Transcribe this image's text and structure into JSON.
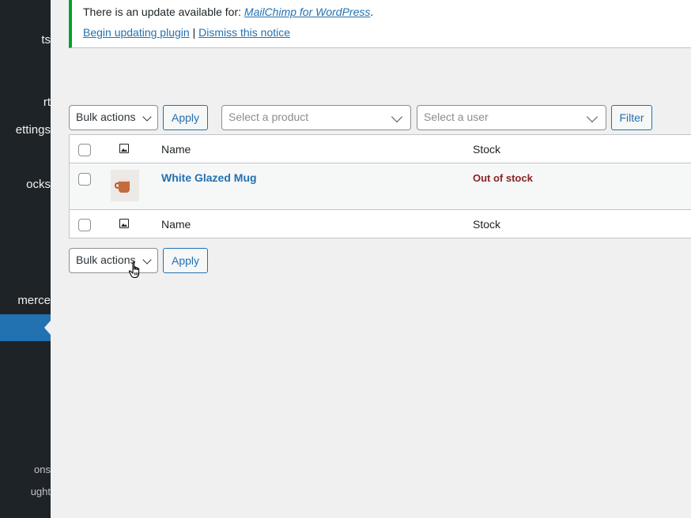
{
  "sidebar": {
    "items": [
      {
        "label": "ts"
      },
      {
        "label": "rt"
      },
      {
        "label": "ettings"
      },
      {
        "label": "ocks"
      },
      {
        "label": "merce"
      },
      {
        "label": "ons"
      },
      {
        "label": "ught"
      }
    ]
  },
  "notice": {
    "prefix": "There is an update available for: ",
    "plugin_name": "MailChimp for WordPress",
    "suffix": ".",
    "begin_link": "Begin updating plugin",
    "separator": "|",
    "dismiss_link": "Dismiss this notice"
  },
  "top_controls": {
    "bulk_actions": "Bulk actions",
    "apply": "Apply",
    "product_placeholder": "Select a product",
    "user_placeholder": "Select a user",
    "filter": "Filter"
  },
  "table": {
    "columns": {
      "name": "Name",
      "stock": "Stock"
    },
    "rows": [
      {
        "name": "White Glazed Mug",
        "stock": "Out of stock"
      }
    ]
  },
  "bottom_controls": {
    "bulk_actions": "Bulk actions",
    "apply": "Apply"
  },
  "colors": {
    "sidebar_bg": "#1d2327",
    "accent": "#2271b1",
    "notice_border": "#00a32a",
    "out_of_stock": "#8a2424"
  }
}
